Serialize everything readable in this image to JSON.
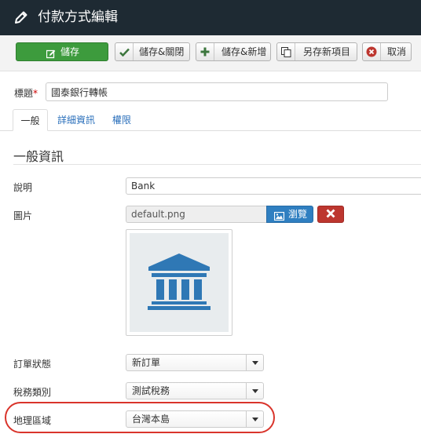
{
  "header": {
    "title": "付款方式編輯",
    "icon": "pencil-icon"
  },
  "toolbar": {
    "save_label": "儲存",
    "save_close_label": "儲存&關閉",
    "save_new_label": "儲存&新增",
    "save_copy_label": "另存新項目",
    "cancel_label": "取消"
  },
  "title_field": {
    "label": "標題",
    "required_mark": "*",
    "value": "國泰銀行轉帳"
  },
  "tabs": [
    {
      "label": "一般",
      "active": true
    },
    {
      "label": "詳細資訊",
      "active": false
    },
    {
      "label": "權限",
      "active": false
    }
  ],
  "section": {
    "heading": "一般資訊"
  },
  "fields": {
    "description": {
      "label": "說明",
      "value": "Bank"
    },
    "image": {
      "label": "圖片",
      "value": "default.png",
      "browse_label": "瀏覽",
      "preview_icon": "bank-icon"
    },
    "order_status": {
      "label": "訂單狀態",
      "value": "新訂單"
    },
    "tax_category": {
      "label": "稅務類別",
      "value": "測試稅務"
    },
    "region": {
      "label": "地理區域",
      "value": "台灣本島"
    }
  },
  "colors": {
    "header_bg": "#1e2a33",
    "save_green": "#3d9b3d",
    "browse_blue": "#2f7fc1",
    "clear_red": "#bd362f",
    "link_blue": "#2a6fbb",
    "highlight_red": "#d9342b"
  }
}
